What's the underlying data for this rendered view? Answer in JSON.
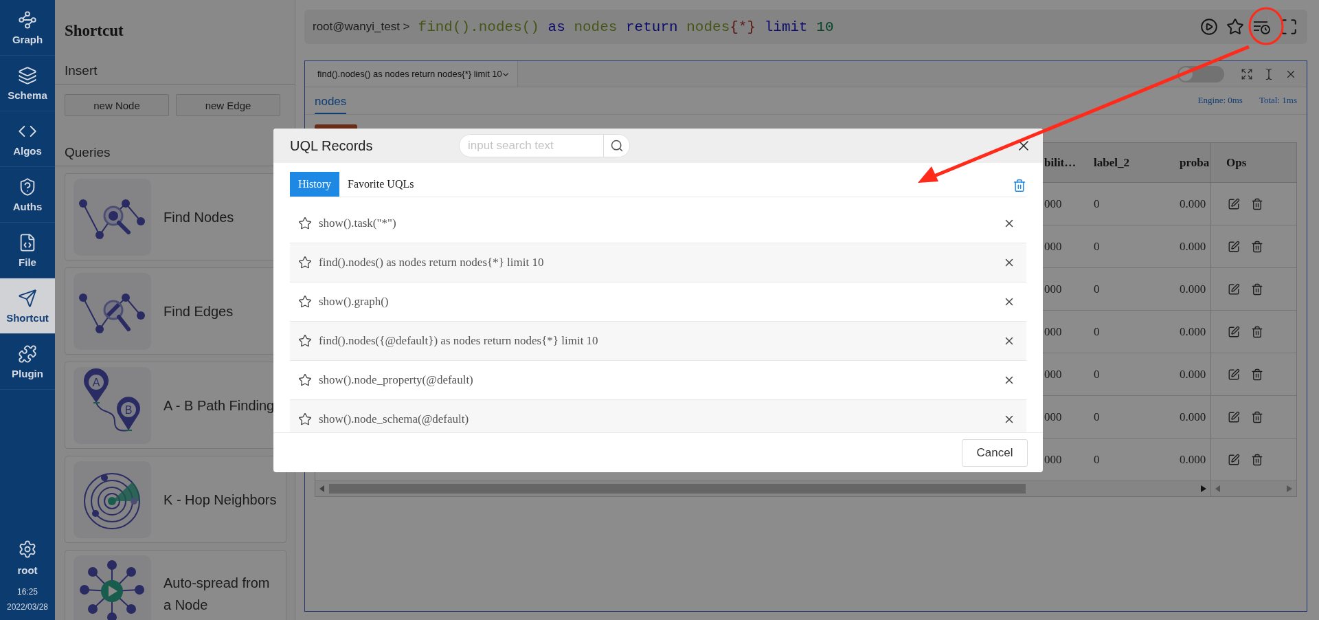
{
  "sidebar": {
    "items": [
      {
        "label": "Graph",
        "kind": "graph",
        "selected": false
      },
      {
        "label": "Schema",
        "kind": "schema",
        "selected": false
      },
      {
        "label": "Algos",
        "kind": "algos",
        "selected": false
      },
      {
        "label": "Auths",
        "kind": "auths",
        "selected": false
      },
      {
        "label": "File",
        "kind": "file",
        "selected": false
      },
      {
        "label": "Shortcut",
        "kind": "shortcut",
        "selected": true
      },
      {
        "label": "Plugin",
        "kind": "plugin",
        "selected": false
      }
    ],
    "user": "root",
    "time": "16:25",
    "date": "2022/03/28"
  },
  "shortcut_panel": {
    "title": "Shortcut",
    "insert": {
      "heading": "Insert",
      "buttons": [
        "new Node",
        "new Edge"
      ]
    },
    "queries": {
      "heading": "Queries",
      "cards": [
        {
          "label": "Find Nodes",
          "kind": "find-nodes"
        },
        {
          "label": "Find Edges",
          "kind": "find-edges"
        },
        {
          "label": "A - B Path Finding",
          "kind": "path",
          "pin_labels": [
            "A",
            "B"
          ]
        },
        {
          "label": "K - Hop Neighbors",
          "kind": "k-hop"
        },
        {
          "label": "Auto-spread from a Node",
          "kind": "spread"
        }
      ]
    }
  },
  "query_bar": {
    "prompt": "root@wanyi_test >",
    "tokens": [
      {
        "text": "find().nodes()",
        "kind": "function"
      },
      {
        "text": " as",
        "kind": "keyword"
      },
      {
        "text": " nodes",
        "kind": "function"
      },
      {
        "text": " return",
        "kind": "keyword"
      },
      {
        "text": " nodes",
        "kind": "function"
      },
      {
        "text": "{",
        "kind": "brace"
      },
      {
        "text": "*",
        "kind": "operator"
      },
      {
        "text": "}",
        "kind": "brace"
      },
      {
        "text": " limit",
        "kind": "keyword"
      },
      {
        "text": " 10",
        "kind": "number"
      }
    ]
  },
  "result_panel": {
    "query_tab": "find().nodes() as nodes return nodes{*} limit 10",
    "view_toggle": {
      "on": false
    },
    "tabs": [
      {
        "label": "nodes",
        "selected": true
      }
    ],
    "engine": "Engine: 0ms",
    "total": "Total: 1ms",
    "table": {
      "columns": [
        "bilit…",
        "label_2",
        "proba",
        "Ops"
      ],
      "rows": [
        {
          "cells": [
            "000",
            "0",
            "0.000"
          ]
        },
        {
          "cells": [
            "000",
            "0",
            "0.000"
          ]
        },
        {
          "cells": [
            "000",
            "0",
            "0.000"
          ]
        },
        {
          "cells": [
            "000",
            "0",
            "0.000"
          ]
        },
        {
          "cells": [
            "000",
            "0",
            "0.000"
          ]
        },
        {
          "cells": [
            "000",
            "0",
            "0.000"
          ]
        },
        {
          "cells": [
            "000",
            "0",
            "0.000"
          ]
        }
      ]
    }
  },
  "modal": {
    "title": "UQL Records",
    "search": {
      "placeholder": "input search text"
    },
    "tabs": [
      {
        "label": "History",
        "selected": true
      },
      {
        "label": "Favorite UQLs",
        "selected": false
      }
    ],
    "records": [
      {
        "text": "show().task(\"*\")",
        "favorite": false
      },
      {
        "text": "find().nodes() as nodes return nodes{*} limit 10",
        "favorite": false
      },
      {
        "text": "show().graph()",
        "favorite": false
      },
      {
        "text": "find().nodes({@default}) as nodes return nodes{*} limit 10",
        "favorite": false
      },
      {
        "text": "show().node_property(@default)",
        "favorite": false
      },
      {
        "text": "show().node_schema(@default)",
        "favorite": false
      }
    ],
    "cancel": "Cancel"
  }
}
